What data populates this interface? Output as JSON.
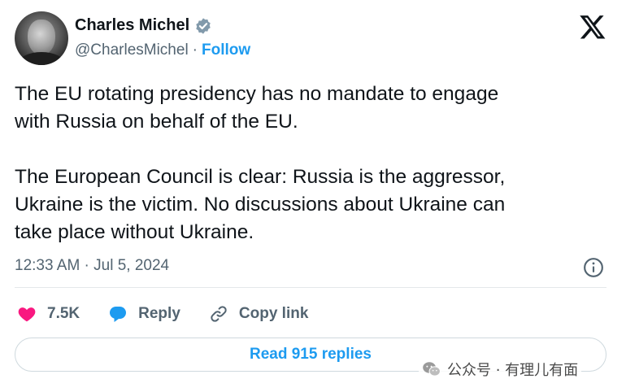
{
  "author": {
    "name": "Charles Michel",
    "handle": "@CharlesMichel",
    "separator": "·",
    "follow_label": "Follow"
  },
  "tweet": {
    "text": "The EU rotating presidency has no mandate to engage\nwith Russia on behalf of the EU.\n\nThe European Council is clear: Russia is the aggressor,\nUkraine is the victim. No discussions about Ukraine can\ntake place without Ukraine.",
    "timestamp": "12:33 AM · Jul 5, 2024"
  },
  "actions": {
    "likes_count": "7.5K",
    "reply_label": "Reply",
    "copy_link_label": "Copy link"
  },
  "read_replies_label": "Read 915 replies",
  "watermark": "公众号 · 有理儿有面",
  "colors": {
    "accent": "#1d9bf0",
    "like": "#f91880",
    "text": "#0f1419",
    "muted": "#536471"
  },
  "icons": [
    "verified-badge-icon",
    "x-logo-icon",
    "info-icon",
    "heart-icon",
    "reply-bubble-icon",
    "link-icon",
    "wechat-icon"
  ]
}
